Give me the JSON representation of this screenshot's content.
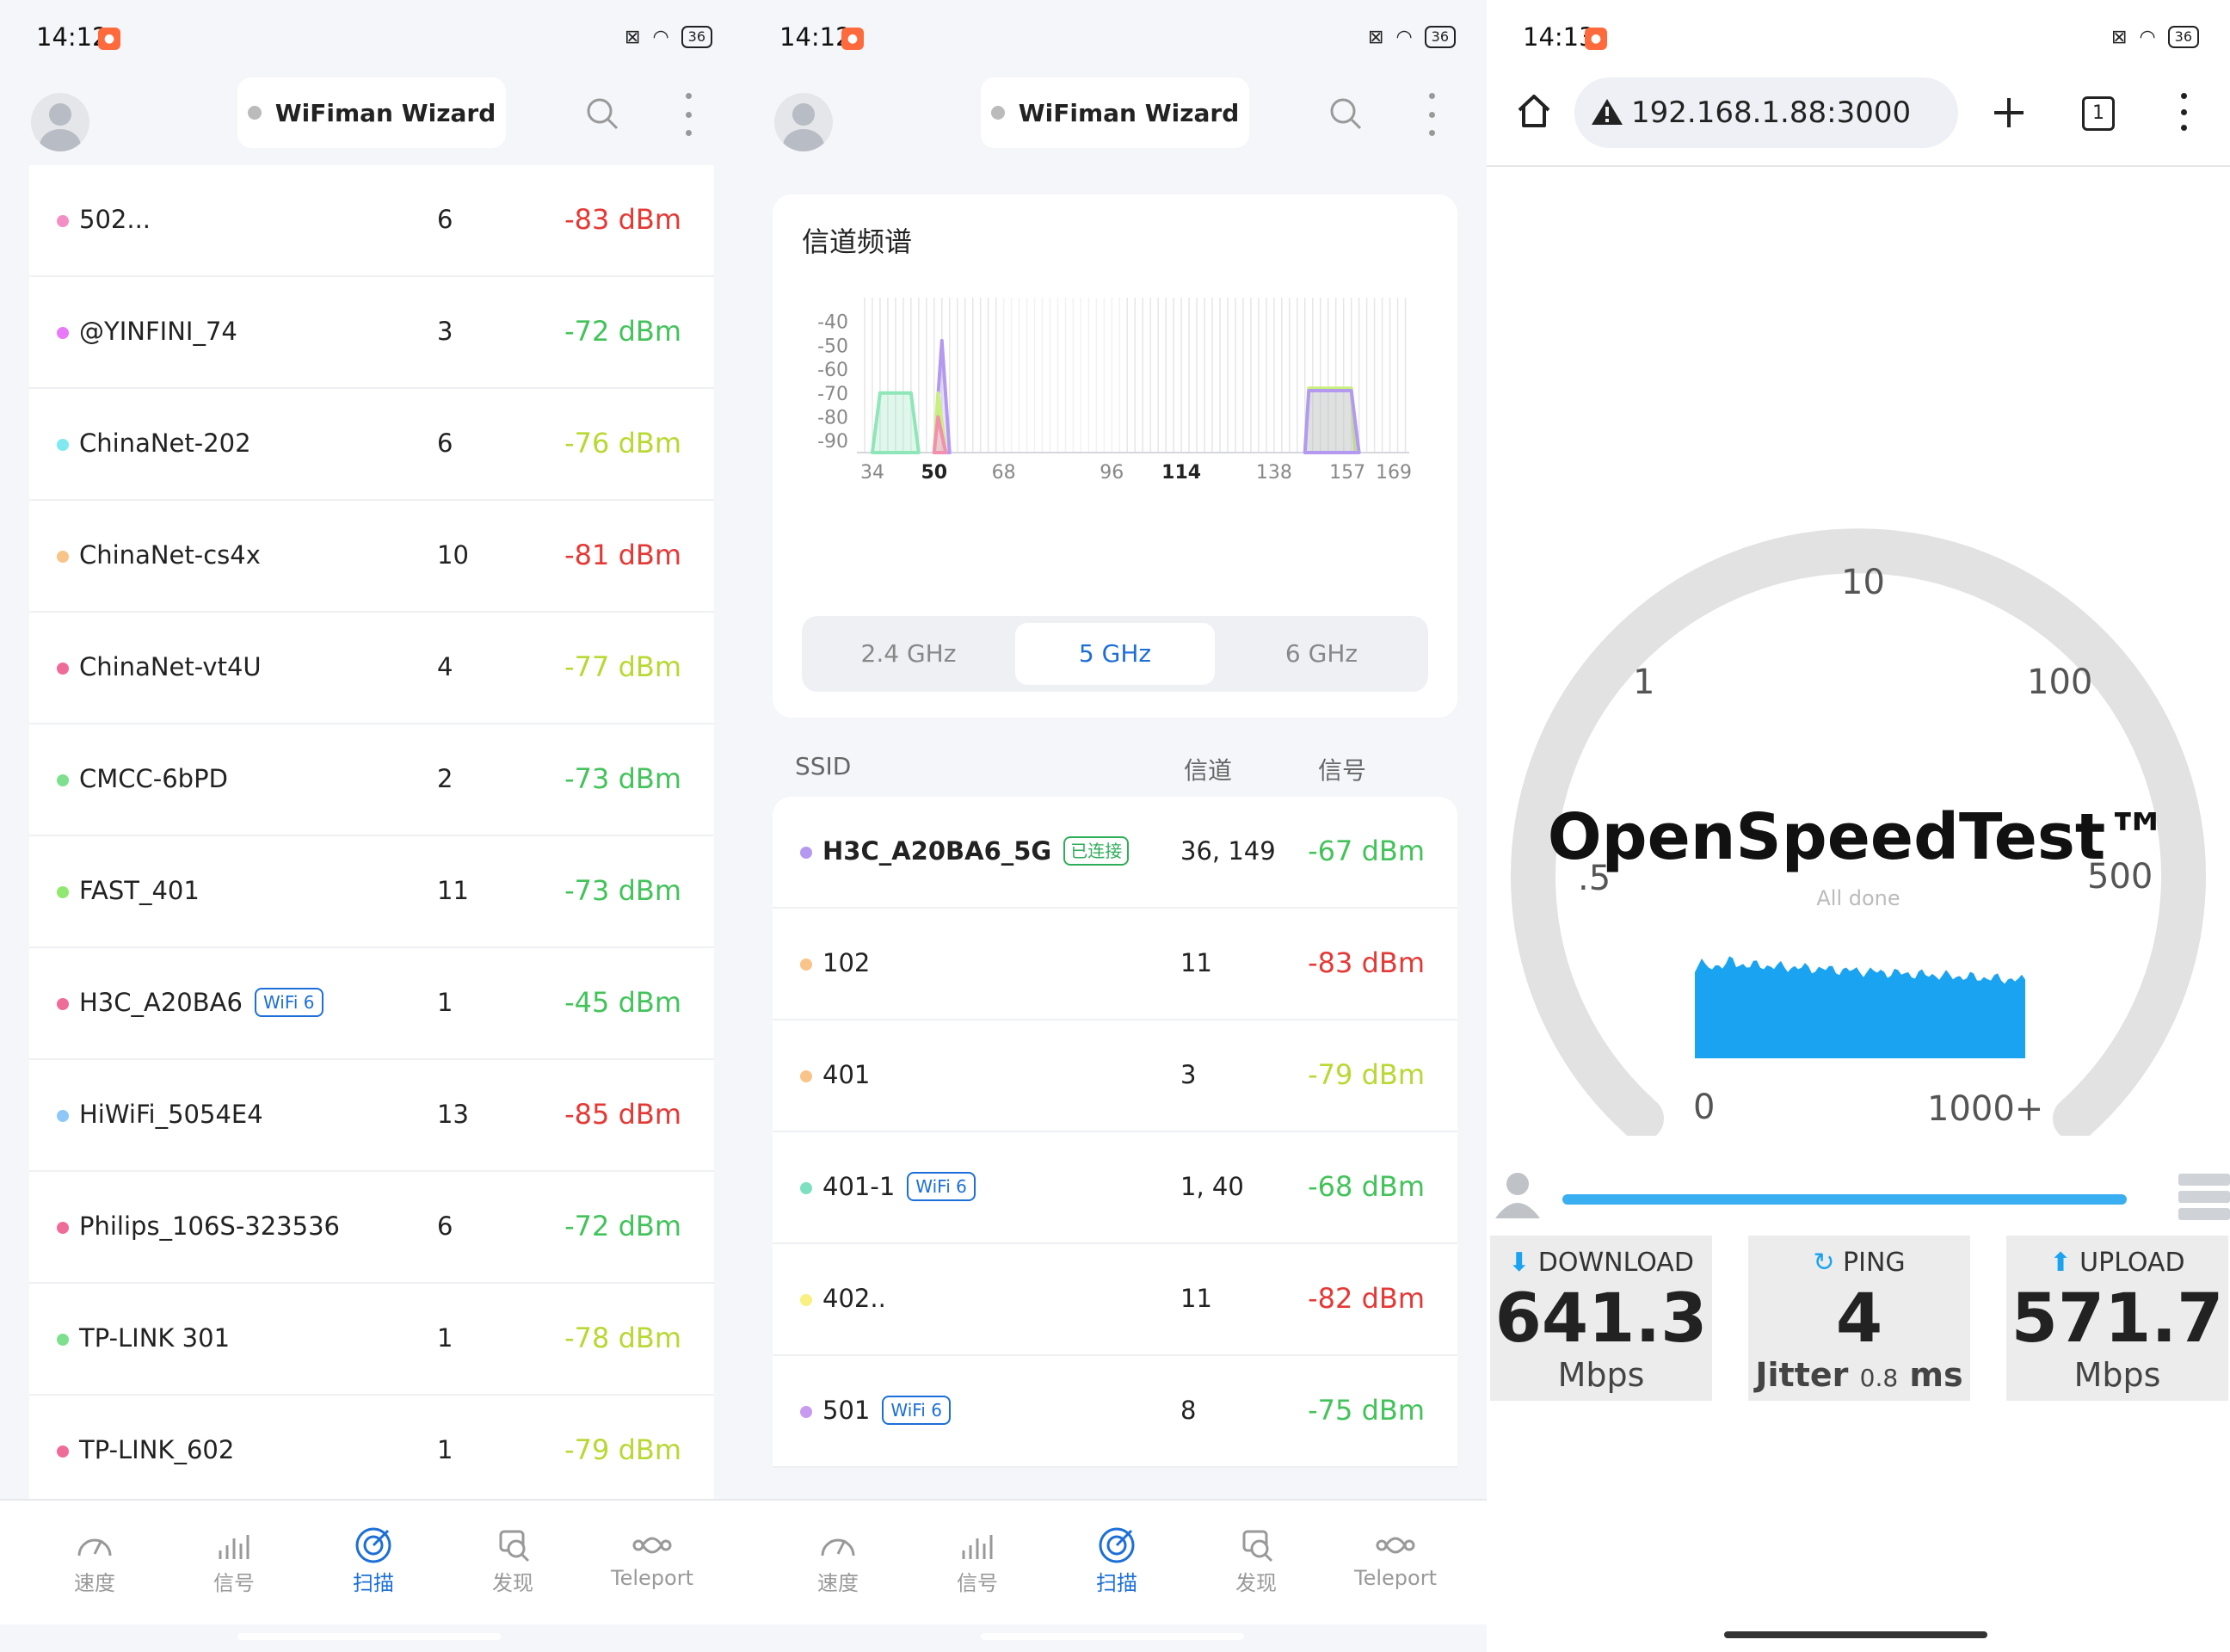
{
  "panel1": {
    "status": {
      "time": "14:12",
      "battery": "36"
    },
    "appbar": {
      "title": "WiFiman Wizard"
    },
    "networks": [
      {
        "ssid": "502...",
        "channel": "6",
        "signal": "-83 dBm",
        "dot_color": "#f48fc6",
        "signal_color": "#e53935"
      },
      {
        "ssid": "@YINFINI_74",
        "channel": "3",
        "signal": "-72 dBm",
        "dot_color": "#e879f9",
        "signal_color": "#43c35a"
      },
      {
        "ssid": "ChinaNet-202",
        "channel": "6",
        "signal": "-76 dBm",
        "dot_color": "#80e8f0",
        "signal_color": "#b8d832"
      },
      {
        "ssid": "ChinaNet-cs4x",
        "channel": "10",
        "signal": "-81 dBm",
        "dot_color": "#f8c48a",
        "signal_color": "#e53935"
      },
      {
        "ssid": "ChinaNet-vt4U",
        "channel": "4",
        "signal": "-77 dBm",
        "dot_color": "#f06c98",
        "signal_color": "#b8d832"
      },
      {
        "ssid": "CMCC-6bPD",
        "channel": "2",
        "signal": "-73 dBm",
        "dot_color": "#7ee08e",
        "signal_color": "#43c35a"
      },
      {
        "ssid": "FAST_401",
        "channel": "11",
        "signal": "-73 dBm",
        "dot_color": "#90e870",
        "signal_color": "#43c35a"
      },
      {
        "ssid": "H3C_A20BA6",
        "tag": "WiFi 6",
        "channel": "1",
        "signal": "-45 dBm",
        "dot_color": "#f06c98",
        "signal_color": "#43c35a"
      },
      {
        "ssid": "HiWiFi_5054E4",
        "channel": "13",
        "signal": "-85 dBm",
        "dot_color": "#8ec8f8",
        "signal_color": "#e53935"
      },
      {
        "ssid": "Philips_106S-323536",
        "channel": "6",
        "signal": "-72 dBm",
        "dot_color": "#f06c98",
        "signal_color": "#43c35a"
      },
      {
        "ssid": "TP-LINK 301",
        "channel": "1",
        "signal": "-78 dBm",
        "dot_color": "#7ee08e",
        "signal_color": "#b8d832"
      },
      {
        "ssid": "TP-LINK_602",
        "channel": "1",
        "signal": "-79 dBm",
        "dot_color": "#f06c98",
        "signal_color": "#b8d832"
      }
    ]
  },
  "nav": {
    "speed": "速度",
    "signal": "信号",
    "scan": "扫描",
    "discover": "发现",
    "teleport": "Teleport"
  },
  "panel2": {
    "status": {
      "time": "14:12",
      "battery": "36"
    },
    "appbar": {
      "title": "WiFiman Wizard"
    },
    "spectrum_title": "信道频谱",
    "bands": [
      "2.4 GHz",
      "5 GHz",
      "6 GHz"
    ],
    "selected_band": "5 GHz",
    "header": {
      "ssid": "SSID",
      "channel": "信道",
      "signal": "信号"
    },
    "networks": [
      {
        "ssid": "H3C_A20BA6_5G",
        "tag": "已连接",
        "channel": "36, 149",
        "signal": "-67 dBm",
        "dot_color": "#b39af0",
        "signal_color": "#43c35a"
      },
      {
        "ssid": "102",
        "channel": "11",
        "signal": "-83 dBm",
        "dot_color": "#f8c48a",
        "signal_color": "#e53935"
      },
      {
        "ssid": "401",
        "channel": "3",
        "signal": "-79 dBm",
        "dot_color": "#f8c48a",
        "signal_color": "#b8d832"
      },
      {
        "ssid": "401-1",
        "tag": "WiFi 6",
        "channel": "1, 40",
        "signal": "-68 dBm",
        "dot_color": "#7ee0c0",
        "signal_color": "#43c35a"
      },
      {
        "ssid": "402..",
        "channel": "11",
        "signal": "-82 dBm",
        "dot_color": "#f8f080",
        "signal_color": "#e53935"
      },
      {
        "ssid": "501",
        "tag": "WiFi 6",
        "channel": "8",
        "signal": "-75 dBm",
        "dot_color": "#c89af0",
        "signal_color": "#43c35a"
      }
    ]
  },
  "chart_data": {
    "type": "area",
    "title": "信道频谱",
    "x_ticks": [
      "34",
      "50",
      "68",
      "96",
      "114",
      "138",
      "157",
      "169"
    ],
    "x_ticks_bold": [
      "50",
      "114"
    ],
    "y_ticks": [
      "-40",
      "-50",
      "-60",
      "-70",
      "-80",
      "-90"
    ],
    "ylim": [
      -95,
      -30
    ],
    "series": [
      {
        "color": "#8fe6b8",
        "points": [
          [
            34,
            -95
          ],
          [
            36,
            -70
          ],
          [
            44,
            -70
          ],
          [
            46,
            -95
          ]
        ]
      },
      {
        "color": "#b39af0",
        "points": [
          [
            50,
            -95
          ],
          [
            52,
            -48
          ],
          [
            54,
            -95
          ]
        ]
      },
      {
        "color": "#c8f07a",
        "points": [
          [
            50,
            -95
          ],
          [
            51,
            -70
          ],
          [
            53,
            -95
          ]
        ]
      },
      {
        "color": "#f48fb1",
        "points": [
          [
            50,
            -95
          ],
          [
            51,
            -80
          ],
          [
            53,
            -95
          ]
        ]
      },
      {
        "color": "#c8f07a",
        "points": [
          [
            146,
            -95
          ],
          [
            147,
            -68
          ],
          [
            158,
            -68
          ],
          [
            159,
            -95
          ]
        ]
      },
      {
        "color": "#b39af0",
        "points": [
          [
            146,
            -95
          ],
          [
            147,
            -69
          ],
          [
            158,
            -69
          ],
          [
            160,
            -95
          ]
        ]
      }
    ]
  },
  "panel3": {
    "status": {
      "time": "14:13",
      "battery": "36"
    },
    "url": "192.168.1.88:3000",
    "tab_count": "1",
    "gauge_labels": [
      "10",
      "1",
      "100",
      ".5",
      "500",
      "0",
      "1000+"
    ],
    "brand": "OpenSpeedTest™",
    "status_text": "All done",
    "progress": 1.0,
    "download": {
      "label": "DOWNLOAD",
      "value": "641.3",
      "unit": "Mbps"
    },
    "ping": {
      "label": "PING",
      "value": "4",
      "jitter_label": "Jitter",
      "jitter_value": "0.8",
      "jitter_unit": "ms"
    },
    "upload": {
      "label": "UPLOAD",
      "value": "571.7",
      "unit": "Mbps"
    }
  }
}
